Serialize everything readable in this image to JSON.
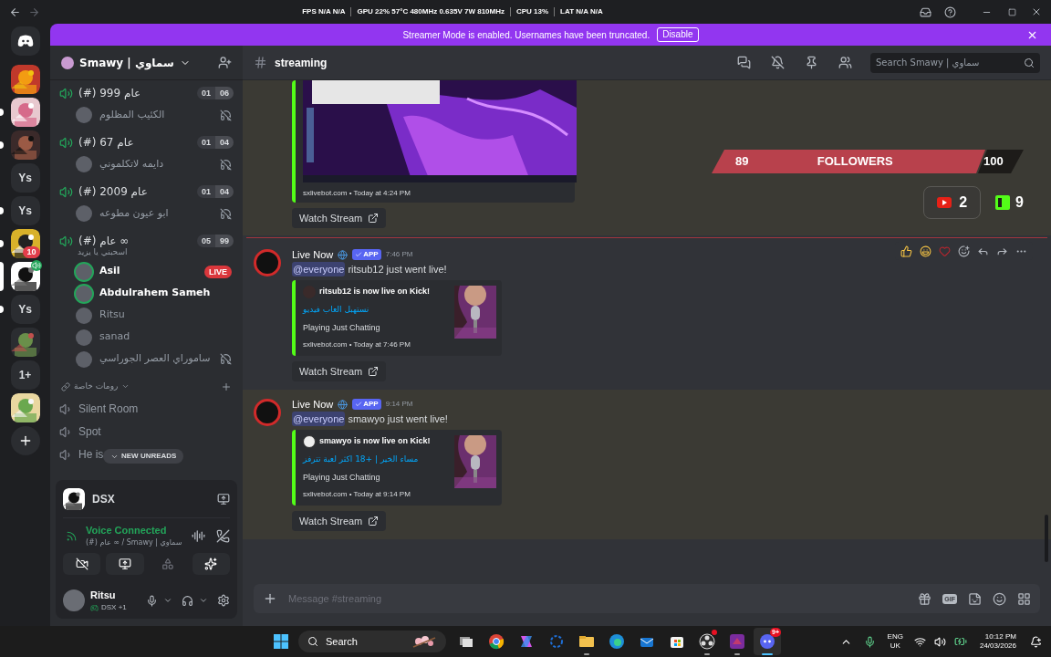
{
  "titlebar": {
    "stats": [
      "FPS N/A N/A",
      "GPU 22% 57°C 480MHz 0.635V 7W 810MHz",
      "CPU 13%",
      "LAT N/A N/A"
    ]
  },
  "banner": {
    "message": "Streamer Mode is enabled. Usernames have been truncated.",
    "button": "Disable"
  },
  "servers": [
    {
      "kind": "picture",
      "unread": false,
      "selected": false
    },
    {
      "kind": "picture",
      "unread": true,
      "selected": false
    },
    {
      "kind": "picture",
      "unread": true,
      "selected": false
    },
    {
      "kind": "text",
      "label": "Ys",
      "unread": false,
      "selected": false
    },
    {
      "kind": "text",
      "label": "Ys",
      "unread": true,
      "selected": false
    },
    {
      "kind": "picture",
      "unread": true,
      "selected": false,
      "badge": "10"
    },
    {
      "kind": "picture",
      "unread": false,
      "selected": true,
      "voice": true
    },
    {
      "kind": "text",
      "label": "Ys",
      "unread": true,
      "selected": false
    },
    {
      "kind": "picture",
      "unread": false,
      "selected": false
    },
    {
      "kind": "text",
      "label": "1+",
      "unread": false,
      "selected": false
    },
    {
      "kind": "picture",
      "unread": false,
      "selected": false
    },
    {
      "kind": "add",
      "unread": false,
      "selected": false
    }
  ],
  "server_header": {
    "name": "Smawy | سماوي"
  },
  "voice_channels": [
    {
      "name": "(#) 999 عام",
      "count": "01",
      "limit": "06",
      "members": [
        {
          "name": "الكئيب المظلوم",
          "speaking": false,
          "deafened": true
        }
      ]
    },
    {
      "name": "(#) 67 عام",
      "count": "01",
      "limit": "04",
      "members": [
        {
          "name": "دايمه لاتكلموني",
          "speaking": false,
          "deafened": true
        }
      ]
    },
    {
      "name": "(#) 2009 عام",
      "count": "01",
      "limit": "04",
      "members": [
        {
          "name": "ابو عيون مطوعه",
          "speaking": false,
          "deafened": true
        }
      ]
    },
    {
      "name": "(#) عام ∞",
      "count": "05",
      "limit": "99",
      "status": "اسحبني يا يزيد",
      "members": [
        {
          "name": "Asil",
          "speaking": true,
          "deafened": false,
          "badge": "LIVE"
        },
        {
          "name": "Abdulrahem Sameh",
          "speaking": true,
          "deafened": false
        },
        {
          "name": "Ritsu",
          "speaking": false,
          "deafened": false
        },
        {
          "name": "sanad",
          "speaking": false,
          "deafened": false
        },
        {
          "name": "ساموراي العصر الجوراسي",
          "speaking": false,
          "deafened": true
        }
      ]
    }
  ],
  "category": {
    "name": "رومات خاصة",
    "expanded": true
  },
  "channels": [
    {
      "name": "Silent Room"
    },
    {
      "name": "Spot"
    },
    {
      "name": "He is"
    }
  ],
  "new_unreads": "NEW UNREADS",
  "activity": {
    "name": "DSX"
  },
  "voice": {
    "title": "Voice Connected",
    "subtitle": "(#) عام ∞ / Smawy | سماوي"
  },
  "user": {
    "name": "Ritsu",
    "status": "DSX +1"
  },
  "channel_header": {
    "name": "streaming",
    "search_placeholder": "Search Smawy | سماوي"
  },
  "messages": [
    {
      "kind": "partial",
      "footer": "sxlivebot.com • Today at 4:24 PM",
      "button": "Watch Stream",
      "highlighted": true,
      "hovered": false,
      "new_divider": false
    },
    {
      "kind": "full",
      "author": "Live Now",
      "badge": "APP",
      "time": "7:46 PM",
      "mention": "@everyone",
      "text": "ritsub12 just went live!",
      "embed": {
        "title": "ritsub12 is now live on Kick!",
        "link": "نستهبل العاب فيديو",
        "game": "Playing Just Chatting",
        "footer": "sxlivebot.com • Today at 7:46 PM"
      },
      "button": "Watch Stream",
      "highlighted": false,
      "hovered": true,
      "new_divider": true
    },
    {
      "kind": "full",
      "author": "Live Now",
      "badge": "APP",
      "time": "9:14 PM",
      "mention": "@everyone",
      "text": "smawyo just went live!",
      "embed": {
        "title": "smawyo is now live on Kick!",
        "link": "مساء الخير | +18 اكثر لعبة تترفز",
        "game": "Playing Just Chatting",
        "footer": "sxlivebot.com • Today at 9:14 PM"
      },
      "button": "Watch Stream",
      "highlighted": true,
      "hovered": false,
      "new_divider": false
    }
  ],
  "overlay": {
    "followers": {
      "current": "89",
      "label": "FOLLOWERS",
      "goal": "100"
    },
    "counters": [
      {
        "kind": "youtube",
        "count": "2"
      },
      {
        "kind": "kick",
        "count": "9"
      }
    ]
  },
  "composer": {
    "placeholder": "Message #streaming",
    "gif_label": "GIF"
  },
  "taskbar": {
    "search": "Search",
    "apps": [
      {
        "kind": "taskview",
        "running": false,
        "selected": false
      },
      {
        "kind": "chrome",
        "running": false,
        "selected": false
      },
      {
        "kind": "office",
        "running": false,
        "selected": false
      },
      {
        "kind": "ring",
        "running": false,
        "selected": false
      },
      {
        "kind": "folder",
        "running": true,
        "selected": false
      },
      {
        "kind": "edge",
        "running": false,
        "selected": false
      },
      {
        "kind": "mail",
        "running": false,
        "selected": false
      },
      {
        "kind": "store",
        "running": false,
        "selected": false
      },
      {
        "kind": "obs",
        "running": true,
        "selected": false,
        "alert": true
      },
      {
        "kind": "game",
        "running": true,
        "selected": false
      },
      {
        "kind": "discord",
        "running": false,
        "selected": true,
        "badge": "9+"
      }
    ],
    "language": "ENG",
    "region": "UK",
    "time": "10:12 PM",
    "date": "24/03/2026"
  }
}
